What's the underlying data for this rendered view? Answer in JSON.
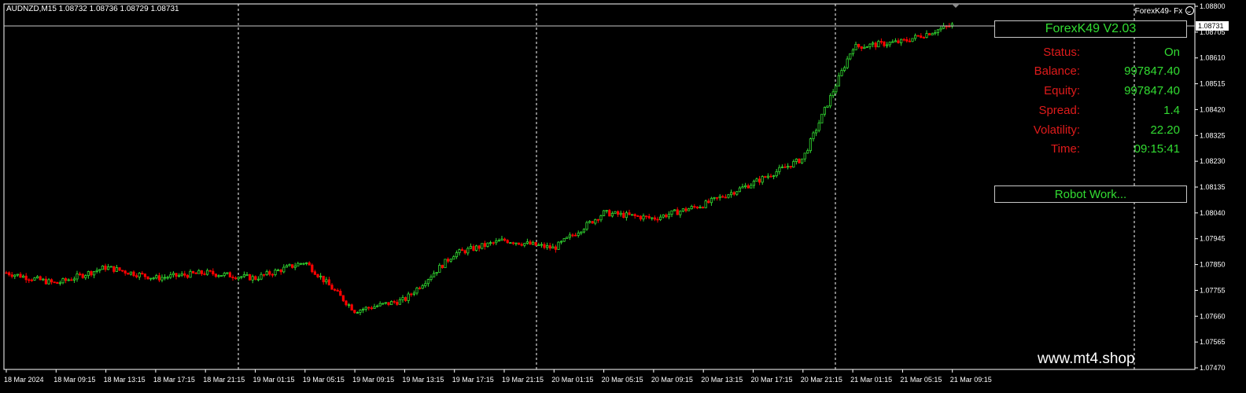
{
  "chart": {
    "symbol_header": "AUDNZD,M15  1.08732 1.08736 1.08729 1.08731",
    "ea_name": "ForexK49- Fx",
    "ea_icon": "smiley-icon",
    "current_price": "1.08731",
    "y_ticks": [
      "1.08800",
      "1.08705",
      "1.08610",
      "1.08515",
      "1.08420",
      "1.08325",
      "1.08230",
      "1.08135",
      "1.08040",
      "1.07945",
      "1.07850",
      "1.07755",
      "1.07660",
      "1.07565",
      "1.07470"
    ],
    "x_ticks": [
      "18 Mar 2024",
      "18 Mar 09:15",
      "18 Mar 13:15",
      "18 Mar 17:15",
      "18 Mar 21:15",
      "19 Mar 01:15",
      "19 Mar 05:15",
      "19 Mar 09:15",
      "19 Mar 13:15",
      "19 Mar 17:15",
      "19 Mar 21:15",
      "20 Mar 01:15",
      "20 Mar 05:15",
      "20 Mar 09:15",
      "20 Mar 13:15",
      "20 Mar 17:15",
      "20 Mar 21:15",
      "21 Mar 01:15",
      "21 Mar 05:15",
      "21 Mar 09:15"
    ],
    "colors": {
      "background": "#000000",
      "bull": "#32dc32",
      "bear": "#ff0000",
      "grid": "#ffffff",
      "text": "#ffffff"
    }
  },
  "panel": {
    "title": "ForexK49  V2.03",
    "rows": [
      {
        "label": "Status:",
        "value": "On"
      },
      {
        "label": "Balance:",
        "value": "997847.40"
      },
      {
        "label": "Equity:",
        "value": "997847.40"
      },
      {
        "label": "Spread:",
        "value": "1.4"
      },
      {
        "label": "Volatility:",
        "value": "22.20"
      },
      {
        "label": "Time:",
        "value": "09:15:41"
      }
    ],
    "robot_status": "Robot Work..."
  },
  "watermark": "www.mt4.shop",
  "chart_data": {
    "type": "candlestick",
    "symbol": "AUDNZD",
    "timeframe": "M15",
    "last_bar": {
      "open": 1.08732,
      "high": 1.08736,
      "low": 1.08729,
      "close": 1.08731
    },
    "ylim": [
      1.0747,
      1.088
    ],
    "path_times": [
      "18 Mar 2024",
      "18 Mar 09:15",
      "18 Mar 13:15",
      "18 Mar 17:15",
      "18 Mar 21:15",
      "19 Mar 01:15",
      "19 Mar 05:15",
      "19 Mar 09:15",
      "19 Mar 13:15",
      "19 Mar 17:15",
      "19 Mar 21:15",
      "20 Mar 01:15",
      "20 Mar 05:15",
      "20 Mar 09:15",
      "20 Mar 13:15",
      "20 Mar 17:15",
      "20 Mar 21:15",
      "21 Mar 01:15",
      "21 Mar 05:15",
      "21 Mar 09:15"
    ],
    "path_closes": [
      1.0782,
      1.0778,
      1.0784,
      1.078,
      1.0782,
      1.078,
      1.0786,
      1.0768,
      1.0772,
      1.0789,
      1.0794,
      1.0791,
      1.0804,
      1.0802,
      1.0807,
      1.0815,
      1.0824,
      1.0865,
      1.0867,
      1.08731
    ]
  }
}
